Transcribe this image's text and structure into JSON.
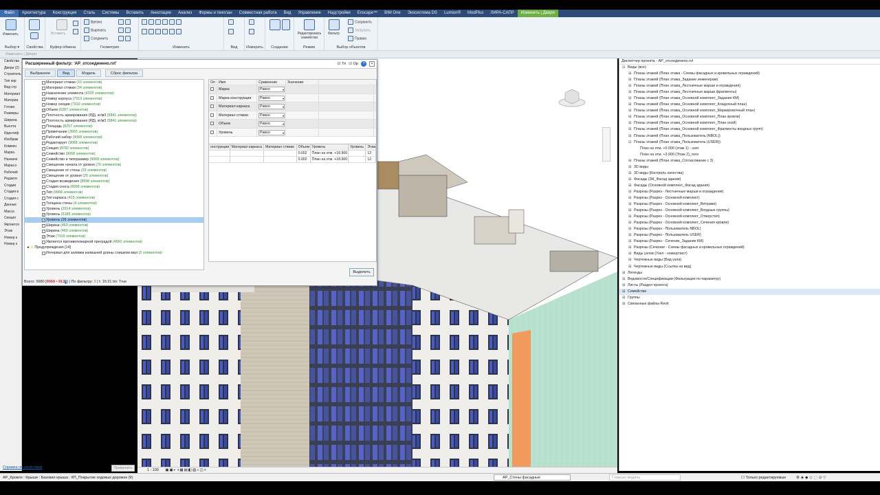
{
  "menu": [
    "Файл",
    "Архитектура",
    "Конструкция",
    "Сталь",
    "Системы",
    "Вставить",
    "Аннотации",
    "Анализ",
    "Формы и генплан",
    "Совместная работа",
    "Вид",
    "Управление",
    "Надстройки",
    "Enscape™",
    "BIM One",
    "Экосистема DS",
    "Lumion®",
    "ModPlus",
    "ЛИРА-САПР",
    "Изменить | Двери"
  ],
  "ribbon": {
    "groups": [
      "Выбор ▾",
      "Свойства",
      "Буфер обмена",
      "Геометрия",
      "Изменить",
      "Вид",
      "Измерить",
      "Создание",
      "Режим",
      "Выбор объектов"
    ],
    "modify": "Изменить",
    "paste": "Вставить",
    "cut": "Врезка",
    "cut2": "Вырезать",
    "join": "Соединить",
    "edit_family": "Редактировать семейство",
    "filter": "Фильтр",
    "save": "Сохранить",
    "load": "Загрузить",
    "edit": "Правка"
  },
  "ctx_line": "Изменить | Двери",
  "left_panel": [
    "Свойства",
    "Двери (2)",
    "Строитель",
    "Тип кар",
    "Вид стр",
    "Материал",
    "Материа",
    "Готово",
    "Размеры",
    "Ширина",
    "Высота",
    "Идентиф",
    "Изображ",
    "Коммен",
    "Марка",
    "Назначе",
    "Марка к",
    "Рабочий",
    "Редакти",
    "Стадии",
    "Стадия в",
    "Стадия с",
    "Данные",
    "Масса",
    "Секция",
    "Является",
    "Этаж",
    "Номер к",
    "Номер к"
  ],
  "dialog": {
    "title": "Расширенный фильтр: 'АР_отсоединено.rvt'",
    "chk_tn": "Тп",
    "chk_op": "Ор",
    "tabs": [
      "Выбранное",
      "Вид",
      "Модель",
      "Сброс фильтра"
    ],
    "tree": [
      {
        "name": "Материал стяжки",
        "count": "(10 элементов)",
        "checked": false
      },
      {
        "name": "Материал стяжки",
        "count": "(34 элементов)",
        "checked": false
      },
      {
        "name": "Назначение элемента",
        "count": "(4205 элементов)",
        "checked": false
      },
      {
        "name": "Номер корпуса",
        "count": "(7919 элементов)",
        "checked": false
      },
      {
        "name": "Номер секции",
        "count": "(7919 элементов)",
        "checked": false
      },
      {
        "name": "Объем",
        "count": "(6287 элементов)",
        "checked": true
      },
      {
        "name": "Плотность армирования (РД), кг/м3",
        "count": "(5841 элементов)",
        "checked": false
      },
      {
        "name": "Плотность армирования (РД), кг/м3",
        "count": "(5841 элементов)",
        "checked": false
      },
      {
        "name": "Площадь",
        "count": "(8257 элементов)",
        "checked": false
      },
      {
        "name": "Примечание",
        "count": "(3665 элементов)",
        "checked": false
      },
      {
        "name": "Рабочий набор",
        "count": "(9068 элементов)",
        "checked": false
      },
      {
        "name": "Редактирует",
        "count": "(9068 элементов)",
        "checked": false
      },
      {
        "name": "Секция",
        "count": "(8782 элементов)",
        "checked": false
      },
      {
        "name": "Семейство",
        "count": "(9068 элементов)",
        "checked": false
      },
      {
        "name": "Семейство и типоразмер",
        "count": "(9068 элементов)",
        "checked": false
      },
      {
        "name": "Смещение начала от уровня",
        "count": "(70 элементов)",
        "checked": false
      },
      {
        "name": "Смещение от стены",
        "count": "(26 элементов)",
        "checked": false
      },
      {
        "name": "Смещение от уровня",
        "count": "(26 элементов)",
        "checked": false
      },
      {
        "name": "Стадия возведения",
        "count": "(8998 элементов)",
        "checked": false
      },
      {
        "name": "Стадия сноса",
        "count": "(8998 элементов)",
        "checked": false
      },
      {
        "name": "Тип",
        "count": "(9068 элементов)",
        "checked": false
      },
      {
        "name": "Тип каркаса",
        "count": "(415 элементов)",
        "checked": false
      },
      {
        "name": "Толщина стены",
        "count": "(4 элементов)",
        "checked": false
      },
      {
        "name": "Уровень",
        "count": "(2914 элементов)",
        "checked": false
      },
      {
        "name": "Уровень",
        "count": "(5185 элементов)",
        "checked": true
      },
      {
        "name": "Уровень",
        "count": "(26 элементов)",
        "checked": true,
        "selected": true
      },
      {
        "name": "Ширина",
        "count": "(460 элементов)",
        "checked": false
      },
      {
        "name": "Ширина",
        "count": "(460 элементов)",
        "checked": false
      },
      {
        "name": "Этаж",
        "count": "(7919 элементов)",
        "checked": true
      },
      {
        "name": "Является противопожарной преградой",
        "count": "(4660 элементов)",
        "checked": false
      }
    ],
    "tree_warn": "Предупреждения [14]",
    "tree_last": "Интервал для заливки излишней длины слишком мал",
    "tree_last_count": "(2 элементов)",
    "grid_header": [
      "Оп",
      "Имя",
      "Сравнение",
      "Значение"
    ],
    "grid_rows": [
      {
        "name": "Марка",
        "cmp": "Равно"
      },
      {
        "name": "Марка конструкции",
        "cmp": "Равно"
      },
      {
        "name": "Материал каркаса",
        "cmp": "Равно"
      },
      {
        "name": "Материал стяжки",
        "cmp": "Равно"
      },
      {
        "name": "Объем",
        "cmp": "Равно"
      },
      {
        "name": "Уровень",
        "cmp": "Равно"
      }
    ],
    "result_header": [
      "онструкции",
      "Материал каркаса",
      "Материал стяжки",
      "Объем",
      "Уровень",
      "Уровень",
      "Этаж"
    ],
    "result_rows": [
      [
        "",
        "",
        "",
        "0.002",
        "План на отм. +18.900",
        "",
        "12"
      ],
      [
        "",
        "",
        "",
        "0.002",
        "План на отм. +18.900",
        "",
        "12"
      ]
    ],
    "status_total": "Всего: 9980",
    "status_sel": "9068 • 912",
    "status_filter": "По фильтру:",
    "status_filter_n": "2",
    "status_time": "t: 16:21 tm: True",
    "ok": "Выделить"
  },
  "project_browser": {
    "title": "Диспетчер проекта - АР_отсоединено.rvt",
    "items": [
      {
        "t": "Виды (все)",
        "lvl": 0,
        "ex": "⊟"
      },
      {
        "t": "Планы этажей (План этажа - Схемы фасадных и кровельных ограждений)",
        "lvl": 1,
        "ex": "⊞"
      },
      {
        "t": "Планы этажей (План этажа_Задание инженерам)",
        "lvl": 1,
        "ex": "⊞"
      },
      {
        "t": "Планы этажей (План этажа_Лестничные марши и ограждения)",
        "lvl": 1,
        "ex": "⊞"
      },
      {
        "t": "Планы этажей (План этажа_Лестничные марши фрагменты)",
        "lvl": 1,
        "ex": "⊞"
      },
      {
        "t": "Планы этажей (План этажа_Основной комплект_Задание КМ)",
        "lvl": 1,
        "ex": "⊞"
      },
      {
        "t": "Планы этажей (План этажа_Основной комплект_Кладочный план)",
        "lvl": 1,
        "ex": "⊞"
      },
      {
        "t": "Планы этажей (План этажа_Основной комплект_Маркировочный план)",
        "lvl": 1,
        "ex": "⊞"
      },
      {
        "t": "Планы этажей (План этажа_Основной комплект_План кровли)",
        "lvl": 1,
        "ex": "⊞"
      },
      {
        "t": "Планы этажей (План этажа_Основной комплект_План осей)",
        "lvl": 1,
        "ex": "⊞"
      },
      {
        "t": "Планы этажей (План этажа_Основной комплект_Фрагменты входных групп)",
        "lvl": 1,
        "ex": "⊞"
      },
      {
        "t": "Планы этажей (План этажа_Пользователь (NBOL))",
        "lvl": 1,
        "ex": "⊞"
      },
      {
        "t": "Планы этажей (План этажа_Пользователь (USER))",
        "lvl": 1,
        "ex": "⊟"
      },
      {
        "t": "План на отм. +0.000 (этаж 1) - user",
        "lvl": 2,
        "ex": ""
      },
      {
        "t": "План на отм. +3.900 (Этаж 2)_теги",
        "lvl": 2,
        "ex": ""
      },
      {
        "t": "Планы этажей (План этажа_Согласование с 3)",
        "lvl": 1,
        "ex": "⊞"
      },
      {
        "t": "3D виды",
        "lvl": 1,
        "ex": "⊞"
      },
      {
        "t": "3D виды (Контроль качества)",
        "lvl": 1,
        "ex": "⊞"
      },
      {
        "t": "Фасады (3Н_Фасад здания)",
        "lvl": 1,
        "ex": "⊞"
      },
      {
        "t": "Фасады (Основной комплект_Фасад здания)",
        "lvl": 1,
        "ex": "⊞"
      },
      {
        "t": "Разрезы (Разрез - Лестничные марши и ограждения)",
        "lvl": 1,
        "ex": "⊞"
      },
      {
        "t": "Разрезы (Разрез - Основной комплект)",
        "lvl": 1,
        "ex": "⊞"
      },
      {
        "t": "Разрезы (Разрез - Основной комплект_Витражи)",
        "lvl": 1,
        "ex": "⊞"
      },
      {
        "t": "Разрезы (Разрез - Основной комплект_Входные группы)",
        "lvl": 1,
        "ex": "⊞"
      },
      {
        "t": "Разрезы (Разрез - Основной комплект_Отверстия)",
        "lvl": 1,
        "ex": "⊞"
      },
      {
        "t": "Разрезы (Разрез - Основной комплект_Сечения кровли)",
        "lvl": 1,
        "ex": "⊞"
      },
      {
        "t": "Разрезы (Разрез - Пользователь NBOL)",
        "lvl": 1,
        "ex": "⊞"
      },
      {
        "t": "Разрезы (Разрез - Пользователь USER)",
        "lvl": 1,
        "ex": "⊞"
      },
      {
        "t": "Разрезы (Разрез - Сечение_Задание КМ)",
        "lvl": 1,
        "ex": "⊞"
      },
      {
        "t": "Разрезы (Сечение - Схемы фасадных и кровельных ограждений)",
        "lvl": 1,
        "ex": "⊞"
      },
      {
        "t": "Виды узлов (Узел - номер/лист)",
        "lvl": 1,
        "ex": "⊞"
      },
      {
        "t": "Чертежные виды (Вид узла)",
        "lvl": 1,
        "ex": "⊞"
      },
      {
        "t": "Чертежные виды (Ссылка на вид)",
        "lvl": 1,
        "ex": "⊞"
      },
      {
        "t": "Легенды",
        "lvl": 0,
        "ex": "⊞"
      },
      {
        "t": "Ведомости/Спецификации (Фильтрация по параметру)",
        "lvl": 0,
        "ex": "⊞"
      },
      {
        "t": "Листы (Раздел проекта)",
        "lvl": 0,
        "ex": "⊞"
      },
      {
        "t": "Семейства",
        "lvl": 0,
        "ex": "⊞",
        "hl": true
      },
      {
        "t": "Группы",
        "lvl": 0,
        "ex": "⊞"
      },
      {
        "t": "Связанные файлы Revit",
        "lvl": 0,
        "ex": "⊞"
      }
    ]
  },
  "bottom": {
    "help": "Справка по свойствам",
    "apply": "Применить",
    "scale": "1 : 100",
    "status": "АР_Кровля : Крыши : Базовая крыша : КП_Покрытие ходовых дорожек (9)",
    "workset": "АР_Стены фасадные",
    "model": "Главная модель",
    "editable": "Только редактируемые"
  }
}
